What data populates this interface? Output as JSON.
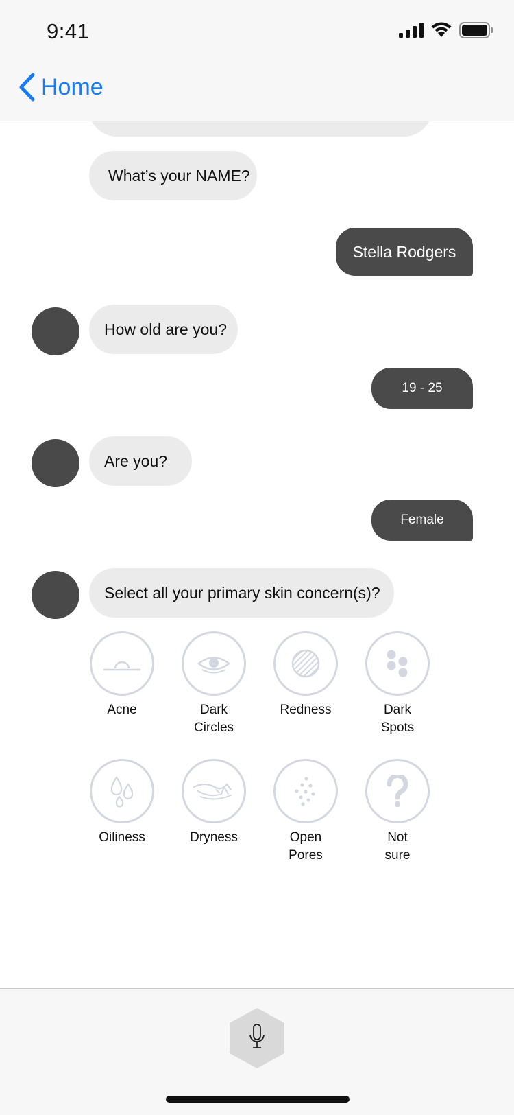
{
  "status_bar": {
    "time": "9:41"
  },
  "nav": {
    "back_label": "Home"
  },
  "messages": {
    "name_question": "What’s your NAME?",
    "name_answer": "Stella Rodgers",
    "age_question": "How old are you?",
    "age_answer": "19 - 25",
    "gender_question": "Are you?",
    "gender_answer": "Female",
    "concern_question": "Select all your primary skin concern(s)?"
  },
  "concerns": [
    {
      "label": "Acne",
      "icon": "acne-icon"
    },
    {
      "label": "Dark\nCircles",
      "icon": "eye-icon"
    },
    {
      "label": "Redness",
      "icon": "striped-circle-icon"
    },
    {
      "label": "Dark\nSpots",
      "icon": "spots-icon"
    },
    {
      "label": "Oiliness",
      "icon": "drops-icon"
    },
    {
      "label": "Dryness",
      "icon": "dry-skin-icon"
    },
    {
      "label": "Open\nPores",
      "icon": "pores-icon"
    },
    {
      "label": "Not\nsure",
      "icon": "question-icon"
    }
  ],
  "colors": {
    "accent": "#1a7cf5",
    "outgoing_bubble": "#4a4a4a",
    "incoming_bubble": "#ebebeb",
    "icon_outline": "#d3d7df"
  }
}
